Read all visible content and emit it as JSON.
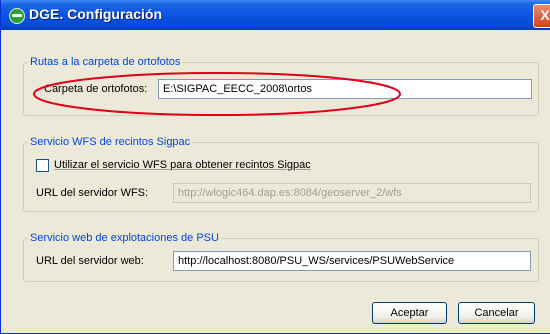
{
  "window": {
    "title": "DGE. Configuración",
    "close_label": "X"
  },
  "ortofotos": {
    "group_title": "Rutas a la carpeta de ortofotos",
    "label": "Carpeta de ortofotos:",
    "value": "E:\\SIGPAC_EECC_2008\\ortos"
  },
  "wfs": {
    "group_title": "Servicio WFS de recintos Sigpac",
    "checkbox_label": "Utilizar el servicio WFS para obtener recintos Sigpac",
    "checked": false,
    "url_label": "URL del servidor WFS:",
    "url_value": "http://wlogic464.dap.es:8084/geoserver_2/wfs"
  },
  "psu": {
    "group_title": "Servicio web de explotaciones de PSU",
    "url_label": "URL del servidor web:",
    "url_value": "http://localhost:8080/PSU_WS/services/PSUWebService"
  },
  "buttons": {
    "accept": "Aceptar",
    "cancel": "Cancelar"
  },
  "colors": {
    "titlebar": "#0a55e3",
    "group_title": "#0046d5",
    "annotation": "#e0001a"
  }
}
